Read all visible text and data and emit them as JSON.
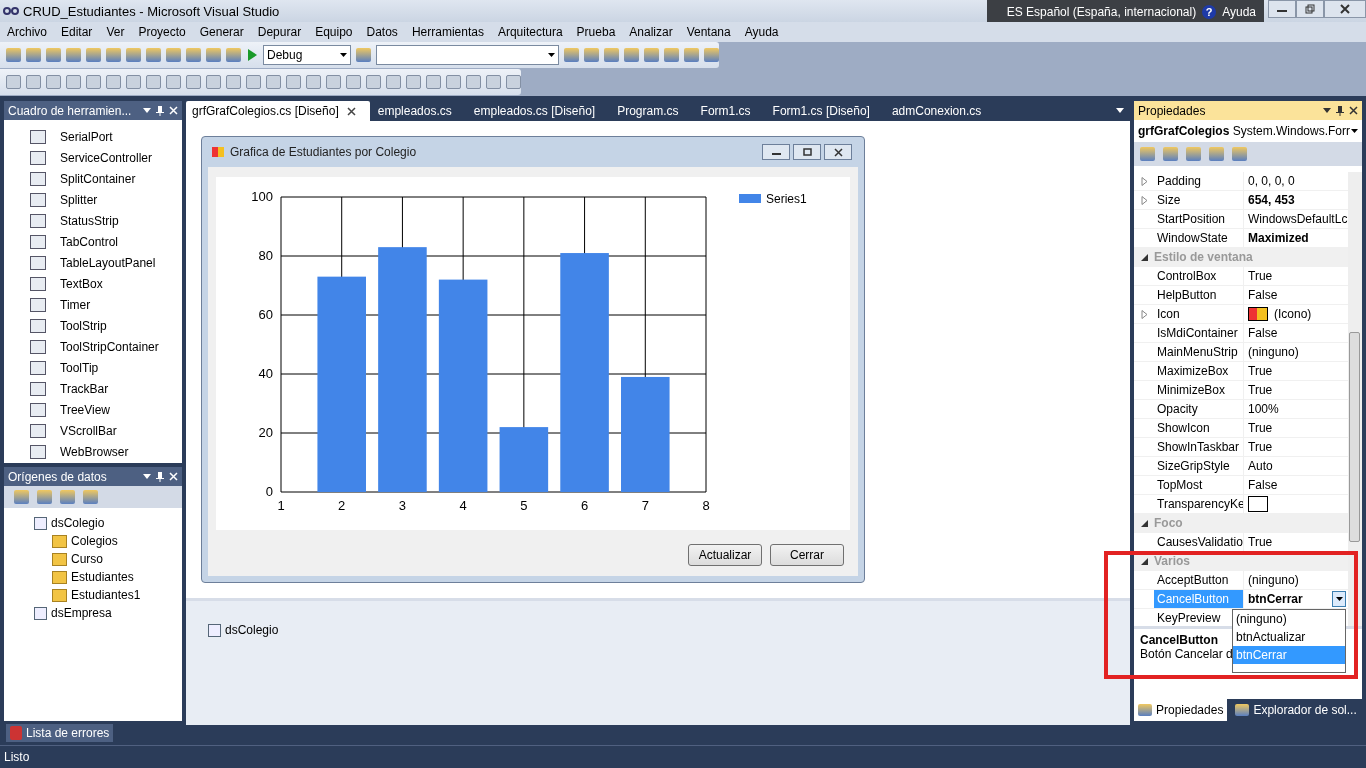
{
  "window": {
    "title": "CRUD_Estudiantes - Microsoft Visual Studio"
  },
  "language_bar": {
    "language": "ES Español (España, internacional)",
    "help_icon": "?",
    "help": "Ayuda"
  },
  "menu": [
    "Archivo",
    "Editar",
    "Ver",
    "Proyecto",
    "Generar",
    "Depurar",
    "Equipo",
    "Datos",
    "Herramientas",
    "Arquitectura",
    "Prueba",
    "Analizar",
    "Ventana",
    "Ayuda"
  ],
  "toolbar": {
    "configuration": "Debug"
  },
  "toolbox": {
    "title": "Cuadro de herramien...",
    "items": [
      "SerialPort",
      "ServiceController",
      "SplitContainer",
      "Splitter",
      "StatusStrip",
      "TabControl",
      "TableLayoutPanel",
      "TextBox",
      "Timer",
      "ToolStrip",
      "ToolStripContainer",
      "ToolTip",
      "TrackBar",
      "TreeView",
      "VScrollBar",
      "WebBrowser"
    ]
  },
  "data_sources": {
    "title": "Orígenes de datos",
    "tree": [
      {
        "label": "dsColegio",
        "children": [
          {
            "label": "Colegios"
          },
          {
            "label": "Curso"
          },
          {
            "label": "Estudiantes"
          },
          {
            "label": "Estudiantes1"
          }
        ]
      },
      {
        "label": "dsEmpresa"
      }
    ]
  },
  "tabs": [
    {
      "label": "grfGrafColegios.cs [Diseño]",
      "selected": true
    },
    {
      "label": "empleados.cs",
      "selected": false
    },
    {
      "label": "empleados.cs [Diseño]",
      "selected": false
    },
    {
      "label": "Program.cs",
      "selected": false
    },
    {
      "label": "Form1.cs",
      "selected": false
    },
    {
      "label": "Form1.cs [Diseño]",
      "selected": false
    },
    {
      "label": "admConexion.cs",
      "selected": false
    }
  ],
  "form": {
    "title": "Grafica de Estudiantes por Colegio",
    "buttons": [
      "Actualizar",
      "Cerrar"
    ],
    "chart_data": {
      "type": "bar",
      "x": [
        2,
        3,
        4,
        5,
        6,
        7
      ],
      "series": [
        {
          "name": "Series1",
          "color": "#4285e8",
          "values": [
            73,
            83,
            72,
            22,
            81,
            39
          ]
        }
      ],
      "xlim": [
        1,
        8
      ],
      "ylim": [
        0,
        100
      ],
      "xticks": [
        1,
        2,
        3,
        4,
        5,
        6,
        7,
        8
      ],
      "yticks": [
        0,
        20,
        40,
        60,
        80,
        100
      ],
      "grid": true
    }
  },
  "component_tray": [
    "dsColegio"
  ],
  "properties": {
    "title": "Propiedades",
    "object": "grfGrafColegios",
    "type": "System.Windows.Forr",
    "rows": [
      {
        "kind": "property",
        "name": "Padding",
        "value": "0, 0, 0, 0",
        "expandable": true,
        "modified": false,
        "selected": false
      },
      {
        "kind": "property",
        "name": "Size",
        "value": "654, 453",
        "expandable": true,
        "modified": true,
        "selected": false
      },
      {
        "kind": "property",
        "name": "StartPosition",
        "value": "WindowsDefaultLc",
        "expandable": false,
        "modified": false,
        "selected": false
      },
      {
        "kind": "property",
        "name": "WindowState",
        "value": "Maximized",
        "expandable": false,
        "modified": true,
        "selected": false
      },
      {
        "kind": "category",
        "name": "Estilo de ventana",
        "expanded": true
      },
      {
        "kind": "property",
        "name": "ControlBox",
        "value": "True",
        "expandable": false,
        "modified": false,
        "selected": false
      },
      {
        "kind": "property",
        "name": "HelpButton",
        "value": "False",
        "expandable": false,
        "modified": false,
        "selected": false
      },
      {
        "kind": "icon",
        "name": "Icon",
        "value": "(Icono)",
        "expandable": true,
        "modified": false,
        "selected": false
      },
      {
        "kind": "property",
        "name": "IsMdiContainer",
        "value": "False",
        "expandable": false,
        "modified": false,
        "selected": false
      },
      {
        "kind": "property",
        "name": "MainMenuStrip",
        "value": "(ninguno)",
        "expandable": false,
        "modified": false,
        "selected": false
      },
      {
        "kind": "property",
        "name": "MaximizeBox",
        "value": "True",
        "expandable": false,
        "modified": false,
        "selected": false
      },
      {
        "kind": "property",
        "name": "MinimizeBox",
        "value": "True",
        "expandable": false,
        "modified": false,
        "selected": false
      },
      {
        "kind": "property",
        "name": "Opacity",
        "value": "100%",
        "expandable": false,
        "modified": false,
        "selected": false
      },
      {
        "kind": "property",
        "name": "ShowIcon",
        "value": "True",
        "expandable": false,
        "modified": false,
        "selected": false
      },
      {
        "kind": "property",
        "name": "ShowInTaskbar",
        "value": "True",
        "expandable": false,
        "modified": false,
        "selected": false
      },
      {
        "kind": "property",
        "name": "SizeGripStyle",
        "value": "Auto",
        "expandable": false,
        "modified": false,
        "selected": false
      },
      {
        "kind": "property",
        "name": "TopMost",
        "value": "False",
        "expandable": false,
        "modified": false,
        "selected": false
      },
      {
        "kind": "color",
        "name": "TransparencyKe",
        "expandable": false,
        "selected": false
      },
      {
        "kind": "category",
        "name": "Foco",
        "expanded": true
      },
      {
        "kind": "property",
        "name": "CausesValidatio",
        "value": "True",
        "expandable": false,
        "modified": false,
        "selected": false
      },
      {
        "kind": "category",
        "name": "Varios",
        "expanded": true
      },
      {
        "kind": "property",
        "name": "AcceptButton",
        "value": "(ninguno)",
        "expandable": false,
        "modified": false,
        "selected": false
      },
      {
        "kind": "dropdown",
        "name": "CancelButton",
        "value": "btnCerrar",
        "expandable": false,
        "modified": true,
        "selected": true
      },
      {
        "kind": "property",
        "name": "KeyPreview",
        "expandable": false,
        "selected": false
      }
    ],
    "dropdown_options": [
      {
        "label": "(ninguno)",
        "selected": false
      },
      {
        "label": "btnActualizar",
        "selected": false
      },
      {
        "label": "btnCerrar",
        "selected": true
      }
    ],
    "description_title": "CancelButton",
    "description": "Botón Cancelar d"
  },
  "right_tabs": [
    {
      "label": "Propiedades",
      "selected": true
    },
    {
      "label": "Explorador de sol...",
      "selected": false
    }
  ],
  "bottom_tabs": [
    "Lista de errores"
  ],
  "status_bar": "Listo"
}
